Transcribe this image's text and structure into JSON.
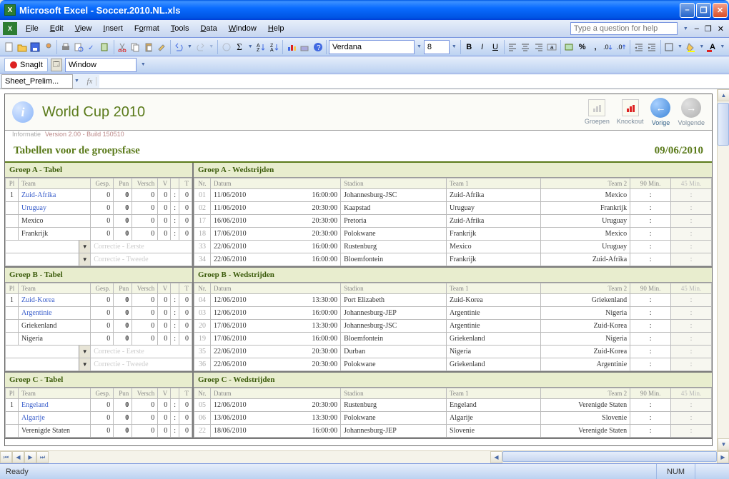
{
  "titlebar": {
    "text": "Microsoft Excel - Soccer.2010.NL.xls"
  },
  "menu": {
    "file": "File",
    "edit": "Edit",
    "view": "View",
    "insert": "Insert",
    "format": "Format",
    "tools": "Tools",
    "data": "Data",
    "window": "Window",
    "help": "Help",
    "question_placeholder": "Type a question for help"
  },
  "toolbar2": {
    "font": "Verdana",
    "size": "8"
  },
  "snagit": {
    "label": "SnagIt",
    "window": "Window"
  },
  "namebox": {
    "value": "Sheet_Prelim...",
    "fx": "fx"
  },
  "card": {
    "title": "World Cup 2010",
    "info_left": "Informatie",
    "version": "Version 2.00 - Build 150510",
    "btn_groepen": "Groepen",
    "btn_knockout": "Knockout",
    "btn_vorige": "Vorige",
    "btn_volgende": "Volgende"
  },
  "subheader": {
    "left": "Tabellen voor de groepsfase",
    "right": "09/06/2010"
  },
  "corr": {
    "first": "Correctie - Eerste",
    "second": "Correctie - Tweede"
  },
  "hdr_tabel": {
    "pl": "Pl",
    "team": "Team",
    "gesp": "Gesp.",
    "pun": "Pun",
    "versch": "Versch",
    "v": "V",
    "t": "T"
  },
  "zerorow": {
    "gesp": "0",
    "pun": "0",
    "versch": "0",
    "v": "0",
    "sep": ":",
    "t": "0"
  },
  "hdr_wed": {
    "nr": "Nr.",
    "datum": "Datum",
    "stadion": "Stadion",
    "team1": "Team 1",
    "team2": "Team 2",
    "m90": "90 Min.",
    "m45": "45 Min."
  },
  "groups": [
    {
      "tabel_title": "Groep A - Tabel",
      "wed_title": "Groep A - Wedstrijden",
      "teams": [
        "Zuid-Afrika",
        "Uruguay",
        "Mexico",
        "Frankrijk"
      ],
      "matches": [
        {
          "nr": "01",
          "date": "11/06/2010",
          "time": "16:00:00",
          "stad": "Johannesburg-JSC",
          "t1": "Zuid-Afrika",
          "t2": "Mexico"
        },
        {
          "nr": "02",
          "date": "11/06/2010",
          "time": "20:30:00",
          "stad": "Kaapstad",
          "t1": "Uruguay",
          "t2": "Frankrijk"
        },
        {
          "nr": "17",
          "date": "16/06/2010",
          "time": "20:30:00",
          "stad": "Pretoria",
          "t1": "Zuid-Afrika",
          "t2": "Uruguay"
        },
        {
          "nr": "18",
          "date": "17/06/2010",
          "time": "20:30:00",
          "stad": "Polokwane",
          "t1": "Frankrijk",
          "t2": "Mexico"
        },
        {
          "nr": "33",
          "date": "22/06/2010",
          "time": "16:00:00",
          "stad": "Rustenburg",
          "t1": "Mexico",
          "t2": "Uruguay"
        },
        {
          "nr": "34",
          "date": "22/06/2010",
          "time": "16:00:00",
          "stad": "Bloemfontein",
          "t1": "Frankrijk",
          "t2": "Zuid-Afrika"
        }
      ]
    },
    {
      "tabel_title": "Groep B - Tabel",
      "wed_title": "Groep B - Wedstrijden",
      "teams": [
        "Zuid-Korea",
        "Argentinie",
        "Griekenland",
        "Nigeria"
      ],
      "matches": [
        {
          "nr": "04",
          "date": "12/06/2010",
          "time": "13:30:00",
          "stad": "Port Elizabeth",
          "t1": "Zuid-Korea",
          "t2": "Griekenland"
        },
        {
          "nr": "03",
          "date": "12/06/2010",
          "time": "16:00:00",
          "stad": "Johannesburg-JEP",
          "t1": "Argentinie",
          "t2": "Nigeria"
        },
        {
          "nr": "20",
          "date": "17/06/2010",
          "time": "13:30:00",
          "stad": "Johannesburg-JSC",
          "t1": "Argentinie",
          "t2": "Zuid-Korea"
        },
        {
          "nr": "19",
          "date": "17/06/2010",
          "time": "16:00:00",
          "stad": "Bloemfontein",
          "t1": "Griekenland",
          "t2": "Nigeria"
        },
        {
          "nr": "35",
          "date": "22/06/2010",
          "time": "20:30:00",
          "stad": "Durban",
          "t1": "Nigeria",
          "t2": "Zuid-Korea"
        },
        {
          "nr": "36",
          "date": "22/06/2010",
          "time": "20:30:00",
          "stad": "Polokwane",
          "t1": "Griekenland",
          "t2": "Argentinie"
        }
      ]
    },
    {
      "tabel_title": "Groep C - Tabel",
      "wed_title": "Groep C - Wedstrijden",
      "teams": [
        "Engeland",
        "Algarije",
        "Verenigde Staten"
      ],
      "matches": [
        {
          "nr": "05",
          "date": "12/06/2010",
          "time": "20:30:00",
          "stad": "Rustenburg",
          "t1": "Engeland",
          "t2": "Verenigde Staten"
        },
        {
          "nr": "06",
          "date": "13/06/2010",
          "time": "13:30:00",
          "stad": "Polokwane",
          "t1": "Algarije",
          "t2": "Slovenie"
        },
        {
          "nr": "22",
          "date": "18/06/2010",
          "time": "16:00:00",
          "stad": "Johannesburg-JEP",
          "t1": "Slovenie",
          "t2": "Verenigde Staten"
        }
      ],
      "partial": true
    }
  ],
  "status": {
    "ready": "Ready",
    "num": "NUM"
  }
}
